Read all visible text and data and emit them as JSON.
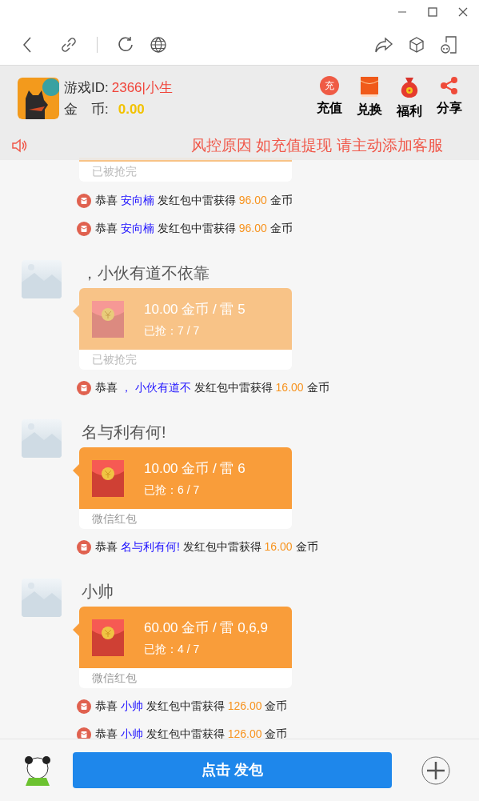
{
  "header": {
    "game_id_label": "游戏ID:",
    "game_id": "2366|小生",
    "coin_label": "金　币:",
    "coins": "0.00",
    "actions": [
      {
        "kind": "recharge",
        "label": "充值",
        "glyph": "充"
      },
      {
        "kind": "exchange",
        "label": "兑换"
      },
      {
        "kind": "bonus",
        "label": "福利"
      },
      {
        "kind": "share",
        "label": "分享"
      }
    ]
  },
  "marquee": "风控原因 如充值提现 请主动添加客服",
  "feed": [
    {
      "kind": "card_tail",
      "opened": true,
      "footer": "已被抢完"
    },
    {
      "kind": "notice",
      "prefix": "恭喜",
      "name": "安向楠",
      "verb": "发红包中雷获得",
      "amount": "96.00",
      "unit": "金币"
    },
    {
      "kind": "notice",
      "prefix": "恭喜",
      "name": "安向楠",
      "verb": "发红包中雷获得",
      "amount": "96.00",
      "unit": "金币"
    },
    {
      "kind": "card",
      "sender": "，小伙有道不依靠",
      "opened": true,
      "title": "10.00 金币 / 雷 5",
      "grabbed": "已抢：7 / 7",
      "footer": "已被抢完"
    },
    {
      "kind": "notice",
      "prefix": "恭喜",
      "name": "， 小伙有道不",
      "verb": "发红包中雷获得",
      "amount": "16.00",
      "unit": "金币"
    },
    {
      "kind": "card",
      "sender": "名与利有何!",
      "opened": false,
      "title": "10.00 金币 / 雷 6",
      "grabbed": "已抢：6 / 7",
      "footer": "微信红包"
    },
    {
      "kind": "notice",
      "prefix": "恭喜",
      "name": "名与利有何!",
      "verb": "发红包中雷获得",
      "amount": "16.00",
      "unit": "金币"
    },
    {
      "kind": "card",
      "sender": "小帅",
      "opened": false,
      "title": "60.00 金币 / 雷 0,6,9",
      "grabbed": "已抢：4 / 7",
      "footer": "微信红包"
    },
    {
      "kind": "notice",
      "prefix": "恭喜",
      "name": "小帅",
      "verb": "发红包中雷获得",
      "amount": "126.00",
      "unit": "金币"
    },
    {
      "kind": "notice",
      "prefix": "恭喜",
      "name": "小帅",
      "verb": "发红包中雷获得",
      "amount": "126.00",
      "unit": "金币"
    }
  ],
  "send_button": "点击 发包"
}
